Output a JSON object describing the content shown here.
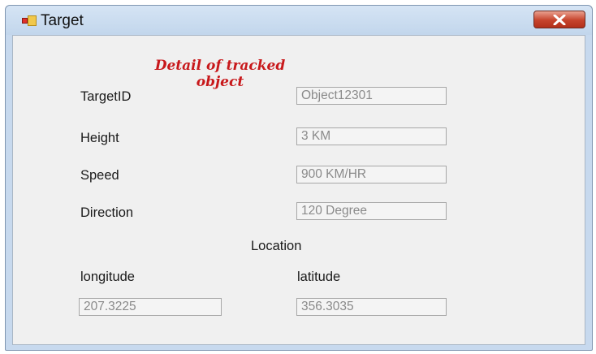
{
  "window": {
    "title": "Target"
  },
  "form": {
    "heading": "Detail of tracked object",
    "rows": [
      {
        "label": "TargetID",
        "value": "Object12301"
      },
      {
        "label": "Height",
        "value": "3 KM"
      },
      {
        "label": "Speed",
        "value": "900 KM/HR"
      },
      {
        "label": "Direction",
        "value": "120 Degree"
      }
    ],
    "location": {
      "title": "Location",
      "longitude_label": "longitude",
      "longitude_value": "207.3225",
      "latitude_label": "latitude",
      "latitude_value": "356.3035"
    }
  },
  "icons": {
    "app": "app-icon",
    "close": "close-icon"
  },
  "colors": {
    "heading": "#c8181b",
    "close_button": "#c6432c",
    "frame": "#c7d9ee"
  }
}
